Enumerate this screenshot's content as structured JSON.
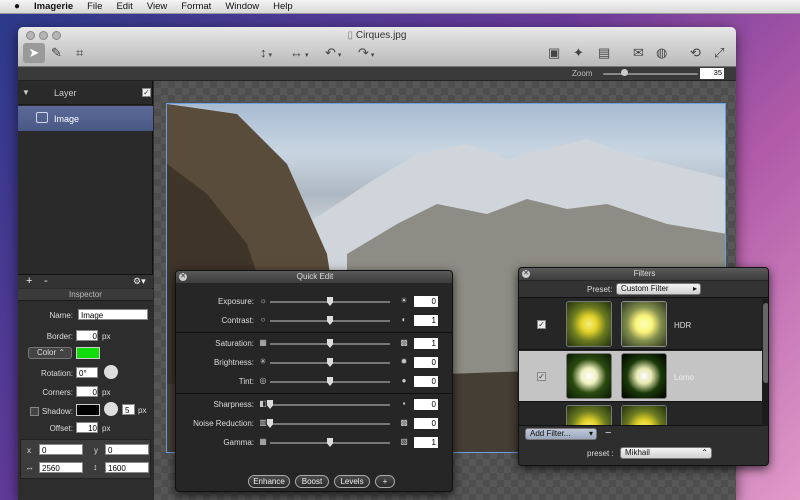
{
  "menubar": {
    "apple": "",
    "app": "Imagerie",
    "items": [
      "File",
      "Edit",
      "View",
      "Format",
      "Window",
      "Help"
    ]
  },
  "window": {
    "title": "Cirques.jpg",
    "zoom_label": "Zoom",
    "zoom_value": "35"
  },
  "layers": {
    "header": "Layer",
    "items": [
      {
        "label": "Image"
      }
    ],
    "add": "+",
    "remove": "-"
  },
  "inspector": {
    "title": "Inspector",
    "name_label": "Name:",
    "name_value": "Image",
    "border_label": "Border:",
    "border_value": "0",
    "px": "px",
    "color_select": "Color",
    "color_swatch": "#12dd0c",
    "rotation_label": "Rotation:",
    "rotation_value": "0°",
    "corners_label": "Corners:",
    "corners_value": "0",
    "shadow_label": "Shadow:",
    "shadow_color": "#000000",
    "shadow_value": "5",
    "offset_label": "Offset:",
    "offset_value": "10",
    "x_label": "x",
    "x_value": "0",
    "y_label": "y",
    "y_value": "0",
    "w_value": "2560",
    "h_value": "1600"
  },
  "quick_edit": {
    "title": "Quick Edit",
    "rows": [
      {
        "label": "Exposure:",
        "value": "0",
        "knob": 0.5,
        "group": 0
      },
      {
        "label": "Contrast:",
        "value": "1",
        "knob": 0.5,
        "group": 0
      },
      {
        "label": "Saturation:",
        "value": "1",
        "knob": 0.5,
        "group": 1
      },
      {
        "label": "Brightness:",
        "value": "0",
        "knob": 0.5,
        "group": 1
      },
      {
        "label": "Tint:",
        "value": "0",
        "knob": 0.5,
        "group": 1
      },
      {
        "label": "Sharpness:",
        "value": "0",
        "knob": 0.0,
        "group": 2
      },
      {
        "label": "Noise Reduction:",
        "value": "0",
        "knob": 0.0,
        "group": 2
      },
      {
        "label": "Gamma:",
        "value": "1",
        "knob": 0.5,
        "group": 2
      }
    ],
    "buttons": [
      "Enhance",
      "Boost",
      "Levels",
      "+"
    ]
  },
  "filters": {
    "title": "Filters",
    "preset_label": "Preset:",
    "preset_value": "Custom Filter",
    "items": [
      {
        "name": "HDR",
        "checked": true
      },
      {
        "name": "Lomo",
        "checked": true
      },
      {
        "name": "",
        "checked": false
      }
    ],
    "add_filter": "Add Filter...",
    "remove": "−",
    "bottom_preset_label": "preset :",
    "bottom_preset_value": "Mikhail"
  }
}
